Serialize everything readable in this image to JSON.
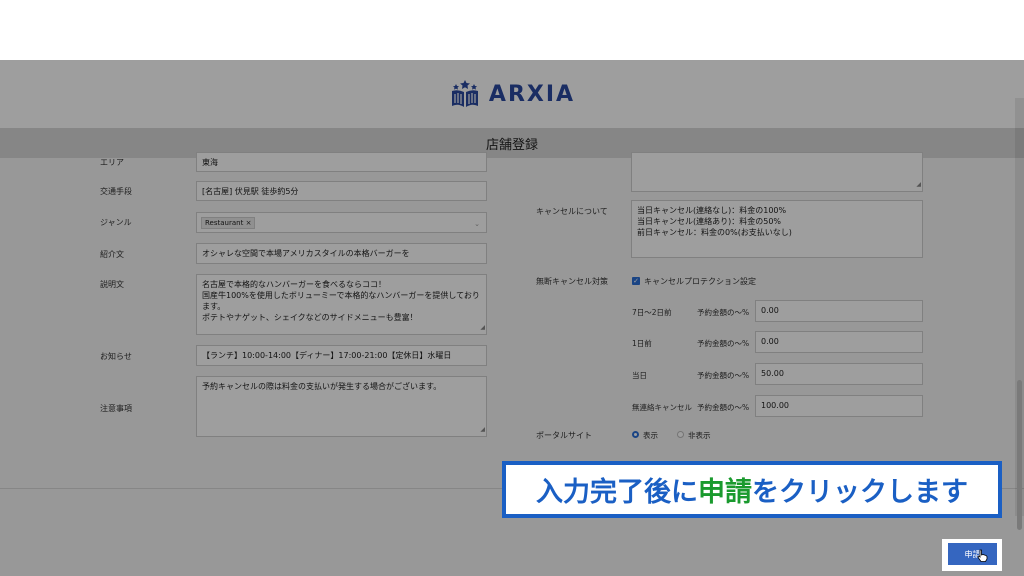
{
  "brand": {
    "name": "ARXIA",
    "color": "#2b4aa0"
  },
  "page_title": "店舗登録",
  "left_fields": {
    "area": {
      "label": "エリア",
      "value": "東海"
    },
    "transport": {
      "label": "交通手段",
      "value": "[名古屋] 伏見駅 徒歩約5分"
    },
    "genre": {
      "label": "ジャンル",
      "tag": "Restaurant",
      "tag_remove": "×"
    },
    "intro": {
      "label": "紹介文",
      "value": "オシャレな空間で本場アメリカスタイルの本格バーガーを"
    },
    "description": {
      "label": "説明文",
      "lines": [
        "名古屋で本格的なハンバーガーを食べるならココ！",
        "国産牛100%を使用したボリューミーで本格的なハンバーガーを提供しております。",
        "ポテトやナゲット、シェイクなどのサイドメニューも豊富！"
      ]
    },
    "notice": {
      "label": "お知らせ",
      "value": "【ランチ】10:00-14:00【ディナー】17:00-21:00【定休日】水曜日"
    },
    "notes": {
      "label": "注意事項",
      "value": "予約キャンセルの際は料金の支払いが発生する場合がございます。"
    }
  },
  "right_fields": {
    "cancel_about": {
      "label": "キャンセルについて",
      "lines": [
        "当日キャンセル(連絡なし)：料金の100%",
        "当日キャンセル(連絡あり)：料金の50%",
        "前日キャンセル：料金の0%(お支払いなし)"
      ]
    },
    "noshow": {
      "label": "無断キャンセル対策",
      "checkbox_label": "キャンセルプロテクション設定",
      "checked": true,
      "rows": [
        {
          "period": "7日～2日前",
          "unit": "予約金額の〜%",
          "value": "0.00"
        },
        {
          "period": "1日前",
          "unit": "予約金額の〜%",
          "value": "0.00"
        },
        {
          "period": "当日",
          "unit": "予約金額の〜%",
          "value": "50.00"
        },
        {
          "period": "無連絡キャンセル",
          "unit": "予約金額の〜%",
          "value": "100.00"
        }
      ]
    },
    "portal": {
      "label": "ポータルサイト",
      "options": [
        "表示",
        "非表示"
      ],
      "selected": "表示"
    }
  },
  "callout": {
    "before": "入力完了後に",
    "highlight": "申請",
    "after": "をクリックします"
  },
  "submit": {
    "label": "申請"
  }
}
